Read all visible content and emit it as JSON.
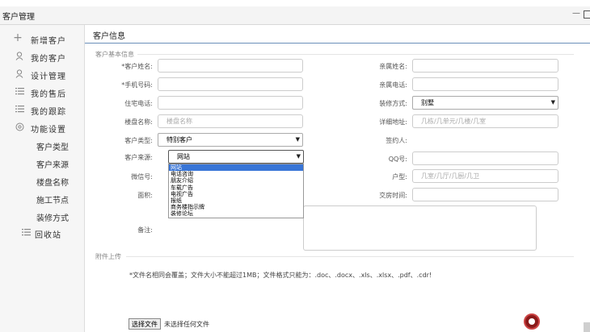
{
  "window": {
    "title": "客户管理",
    "min_label": "—"
  },
  "sidebar": {
    "items": [
      {
        "label": "新增客户",
        "icon": "plus-icon"
      },
      {
        "label": "我的客户",
        "icon": "user-icon"
      },
      {
        "label": "设计管理",
        "icon": "user-icon"
      },
      {
        "label": "我的售后",
        "icon": "list-icon"
      },
      {
        "label": "我的跟踪",
        "icon": "list-icon"
      },
      {
        "label": "功能设置",
        "icon": "gear-icon"
      },
      {
        "label": "客户类型"
      },
      {
        "label": "客户来源"
      },
      {
        "label": "楼盘名称"
      },
      {
        "label": "施工节点"
      },
      {
        "label": "装修方式"
      },
      {
        "label": "回收站",
        "icon": "list-icon"
      }
    ]
  },
  "tab": {
    "label": "客户信息"
  },
  "form": {
    "section_basic": "客户基本信息",
    "customer_name": {
      "label": "*客户姓名:",
      "value": ""
    },
    "phone": {
      "label": "*手机号码:",
      "value": ""
    },
    "home_phone": {
      "label": "住宅电话:",
      "value": ""
    },
    "estate": {
      "label": "楼盘名称:",
      "placeholder": "楼盘名称"
    },
    "customer_type": {
      "label": "客户类型:",
      "value": "特别客户"
    },
    "customer_source": {
      "label": "客户来源:",
      "value": "网站",
      "options": [
        "网站",
        "电话咨询",
        "朋友介绍",
        "车载广告",
        "电视广告",
        "报纸",
        "商务楼指示牌",
        "装修论坛"
      ]
    },
    "wechat": {
      "label": "微信号:"
    },
    "area": {
      "label": "面积:"
    },
    "remark": {
      "label": "备注:"
    },
    "relative_name": {
      "label": "亲属姓名:",
      "value": ""
    },
    "relative_phone": {
      "label": "亲属电话:",
      "value": ""
    },
    "decor_method": {
      "label": "装修方式:",
      "value": "别墅"
    },
    "address": {
      "label": "详细地址:",
      "placeholder": "几栋/几单元/几楼/几室"
    },
    "signer": {
      "label": "签约人:"
    },
    "qq": {
      "label": "QQ号:",
      "value": ""
    },
    "layout": {
      "label": "户型:",
      "placeholder": "几室/几厅/几厨/几卫"
    },
    "handover_time": {
      "label": "交房时间:",
      "value": ""
    },
    "section_attach": "附件上传",
    "attach_note": "*文件名相同会覆盖；文件大小不能超过1MB；文件格式只能为：.doc、.docx、.xls、.xlsx、.pdf、.cdr!",
    "file_button": "选择文件",
    "file_status": "未选择任何文件"
  }
}
